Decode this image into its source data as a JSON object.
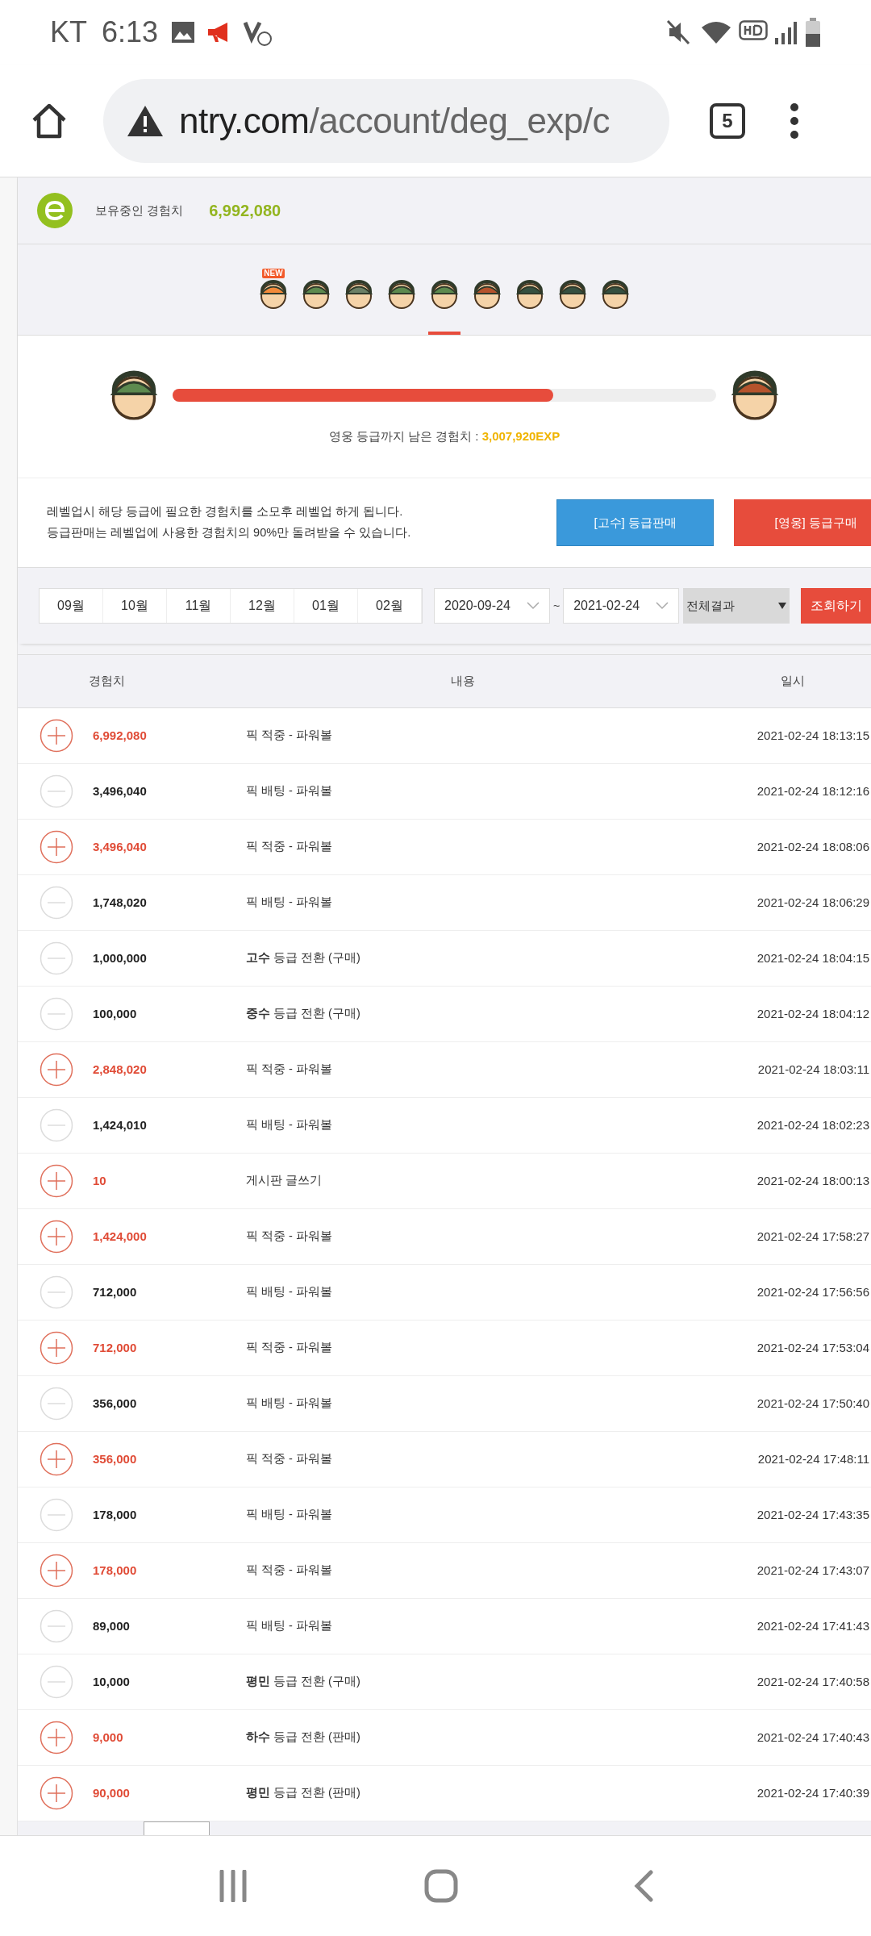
{
  "status_bar": {
    "carrier": "KT",
    "time": "6:13"
  },
  "browser": {
    "url_host": "ntry.com",
    "url_path": "/account/deg_exp/c",
    "tab_count": "5"
  },
  "exp_summary": {
    "label": "보유중인 경험치",
    "value": "6,992,080"
  },
  "grades": [
    {
      "badge": "NEW",
      "selected": false
    },
    {
      "selected": false
    },
    {
      "selected": false
    },
    {
      "selected": false
    },
    {
      "selected": true
    },
    {
      "selected": false
    },
    {
      "selected": false
    },
    {
      "selected": false
    },
    {
      "selected": false
    }
  ],
  "progress": {
    "level": 0.7,
    "remaining_label": "영웅 등급까지 남은 경험치 : ",
    "remaining_value": "3,007,920EXP"
  },
  "info": {
    "lines": [
      "레벨업시 해당 등급에 필요한 경험치를 소모후 레벨업 하게 됩니다.",
      "등급판매는 레벨업에 사용한 경험치의 90%만 돌려받을 수 있습니다."
    ],
    "sell_button": "[고수] 등급판매",
    "buy_button": "[영웅] 등급구매"
  },
  "filter": {
    "months": [
      "09월",
      "10월",
      "11월",
      "12월",
      "01월",
      "02월"
    ],
    "date_from": "2020-09-24",
    "separator": "~",
    "date_to": "2021-02-24",
    "result_select": "전체결과",
    "search_button": "조회하기"
  },
  "table": {
    "columns": [
      "경험치",
      "내용",
      "일시"
    ],
    "rows": [
      {
        "kind": "plus",
        "amount": "6,992,080",
        "content": "픽 적중 - 파워볼",
        "time": "2021-02-24 18:13:15"
      },
      {
        "kind": "minus",
        "amount": "3,496,040",
        "content": "픽 배팅 - 파워볼",
        "time": "2021-02-24 18:12:16"
      },
      {
        "kind": "plus",
        "amount": "3,496,040",
        "content": "픽 적중 - 파워볼",
        "time": "2021-02-24 18:08:06"
      },
      {
        "kind": "minus",
        "amount": "1,748,020",
        "content": "픽 배팅 - 파워볼",
        "time": "2021-02-24 18:06:29"
      },
      {
        "kind": "minus",
        "amount": "1,000,000",
        "content": "**고수** 등급 전환 (구매)",
        "time": "2021-02-24 18:04:15"
      },
      {
        "kind": "minus",
        "amount": "100,000",
        "content": "**중수** 등급 전환 (구매)",
        "time": "2021-02-24 18:04:12"
      },
      {
        "kind": "plus",
        "amount": "2,848,020",
        "content": "픽 적중 - 파워볼",
        "time": "2021-02-24 18:03:11"
      },
      {
        "kind": "minus",
        "amount": "1,424,010",
        "content": "픽 배팅 - 파워볼",
        "time": "2021-02-24 18:02:23"
      },
      {
        "kind": "plus",
        "amount": "10",
        "content": "게시판 글쓰기",
        "time": "2021-02-24 18:00:13"
      },
      {
        "kind": "plus",
        "amount": "1,424,000",
        "content": "픽 적중 - 파워볼",
        "time": "2021-02-24 17:58:27"
      },
      {
        "kind": "minus",
        "amount": "712,000",
        "content": "픽 배팅 - 파워볼",
        "time": "2021-02-24 17:56:56"
      },
      {
        "kind": "plus",
        "amount": "712,000",
        "content": "픽 적중 - 파워볼",
        "time": "2021-02-24 17:53:04"
      },
      {
        "kind": "minus",
        "amount": "356,000",
        "content": "픽 배팅 - 파워볼",
        "time": "2021-02-24 17:50:40"
      },
      {
        "kind": "plus",
        "amount": "356,000",
        "content": "픽 적중 - 파워볼",
        "time": "2021-02-24 17:48:11"
      },
      {
        "kind": "minus",
        "amount": "178,000",
        "content": "픽 배팅 - 파워볼",
        "time": "2021-02-24 17:43:35"
      },
      {
        "kind": "plus",
        "amount": "178,000",
        "content": "픽 적중 - 파워볼",
        "time": "2021-02-24 17:43:07"
      },
      {
        "kind": "minus",
        "amount": "89,000",
        "content": "픽 배팅 - 파워볼",
        "time": "2021-02-24 17:41:43"
      },
      {
        "kind": "minus",
        "amount": "10,000",
        "content": "**평민** 등급 전환 (구매)",
        "time": "2021-02-24 17:40:58"
      },
      {
        "kind": "plus",
        "amount": "9,000",
        "content": "**하수** 등급 전환 (판매)",
        "time": "2021-02-24 17:40:43"
      },
      {
        "kind": "plus",
        "amount": "90,000",
        "content": "**평민** 등급 전환 (판매)",
        "time": "2021-02-24 17:40:39"
      }
    ]
  }
}
